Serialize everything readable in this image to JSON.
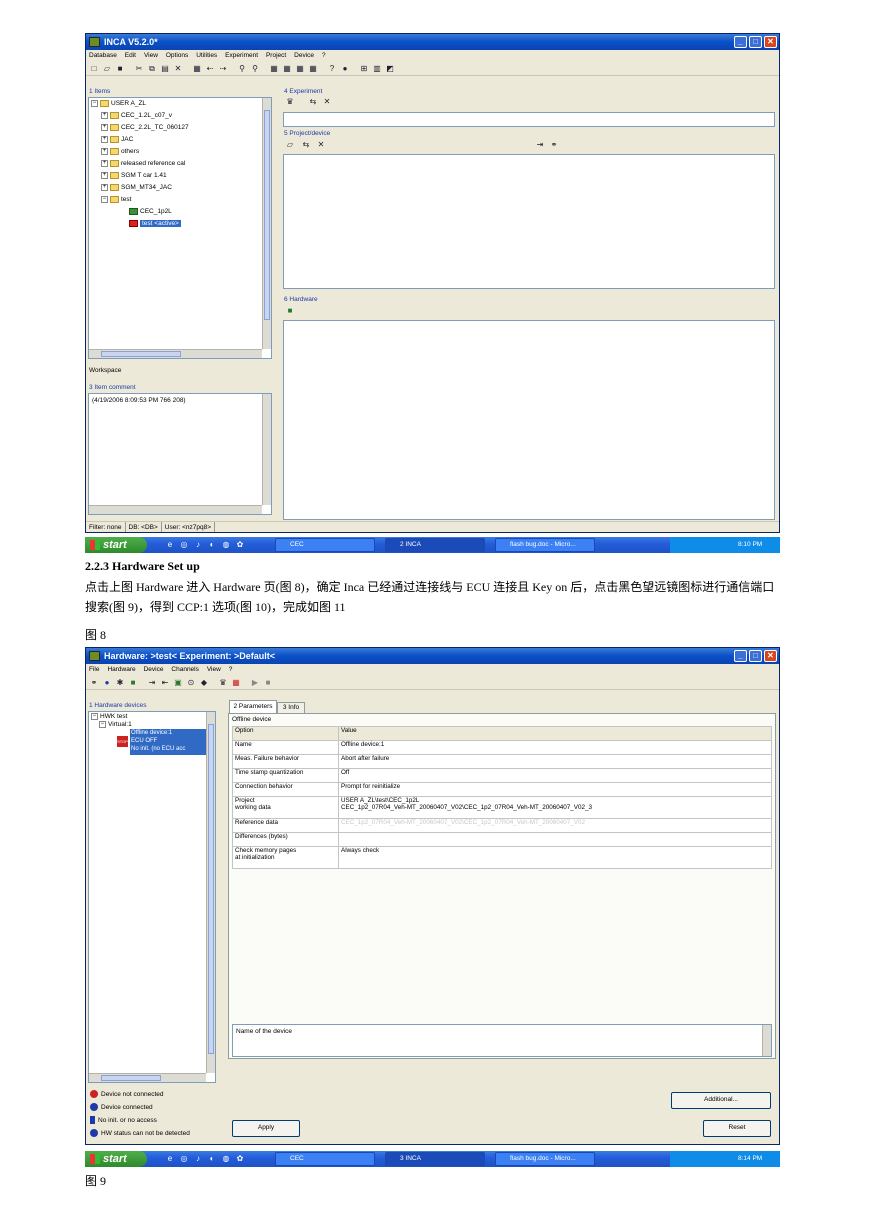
{
  "win1": {
    "title": "INCA V5.2.0*",
    "menu": [
      "Database",
      "Edit",
      "View",
      "Options",
      "Utilities",
      "Experiment",
      "Project",
      "Device",
      "?"
    ],
    "items_label": "1 Items",
    "tree": {
      "root": "USER A_ZL",
      "folders": [
        "CEC_1.2L_c07_v",
        "CEC_2.2L_TC_060127",
        "JAC",
        "others",
        "released reference cal",
        "SGM T car 1.41",
        "SGM_MT34_JAC",
        "test"
      ],
      "children": [
        "CEC_1p2L",
        "test <active>"
      ]
    },
    "workspace_label": "Workspace",
    "item_comment_label": "3 Item comment",
    "item_comment_text": "(4/19/2006 8:09:53 PM 766 208)",
    "experiment_label": "4 Experiment",
    "project_device_label": "5 Project/device",
    "hardware_label": "6 Hardware",
    "status": [
      "Filter: none",
      "DB: <DB>",
      "User: <nz7pq8>"
    ]
  },
  "taskbar1": {
    "start": "start",
    "tasks": [
      "CEC",
      "2 INCA",
      "flash bug.doc - Micro..."
    ],
    "time": "8:10 PM"
  },
  "doc": {
    "heading": "2.2.3 Hardware Set up",
    "paragraph": "点击上图 Hardware 进入 Hardware 页(图 8)，确定 Inca 已经通过连接线与 ECU 连接且 Key on 后，点击黑色望远镜图标进行通信端口搜索(图 9)，得到 CCP:1 选项(图 10)，完成如图 11",
    "fig8": "图 8",
    "fig9": "图 9"
  },
  "win2": {
    "title": "Hardware: >test<  Experiment: >Default<",
    "menu": [
      "File",
      "Hardware",
      "Device",
      "Channels",
      "View",
      "?"
    ],
    "hw_devices_label": "1 Hardware devices",
    "tree": {
      "root": "HWK test",
      "virtual": "Virtual:1",
      "sel_lines": [
        "Offline device:1",
        "ECU OFF",
        "No init. (no ECU acc"
      ]
    },
    "tabs": [
      "2 Parameters",
      "3 Info"
    ],
    "group_label": "Offline device",
    "table_head": [
      "Option",
      "Value"
    ],
    "rows": [
      [
        "Name",
        "Offline device:1"
      ],
      [
        "Meas. Failure behavior",
        "Abort after failure"
      ],
      [
        "Time stamp quantization",
        "Off"
      ],
      [
        "Connection behavior",
        "Prompt for reinitialize"
      ],
      [
        "Project\nworking data",
        "USER A_ZL\\test\\CEC_1p2L\nCEC_1p2_07R04_Veh-MT_20060407_V02\\CEC_1p2_07R04_Veh-MT_20060407_V02_3"
      ],
      [
        "Reference data",
        "CEC_1p2_07R04_Veh-MT_20060407_V02\\CEC_1p2_07R04_Veh-MT_20060407_V02"
      ],
      [
        "Differences (bytes)",
        ""
      ],
      [
        "Check memory pages\nat initialization",
        "Always check"
      ]
    ],
    "description": "Name of the device",
    "additional_btn": "Additional...",
    "apply_btn": "Apply",
    "reset_btn": "Reset",
    "legend": [
      "Device not connected",
      "Device connected",
      "No init. or no access",
      "HW status can not be detected"
    ]
  },
  "taskbar2": {
    "start": "start",
    "tasks": [
      "CEC",
      "3 INCA",
      "flash bug.doc - Micro..."
    ],
    "time": "8:14 PM"
  },
  "colors": {
    "xp_blue": "#0a50c8",
    "selection": "#316ac5",
    "panel": "#ece9d8",
    "taskbar": "#245edb"
  }
}
